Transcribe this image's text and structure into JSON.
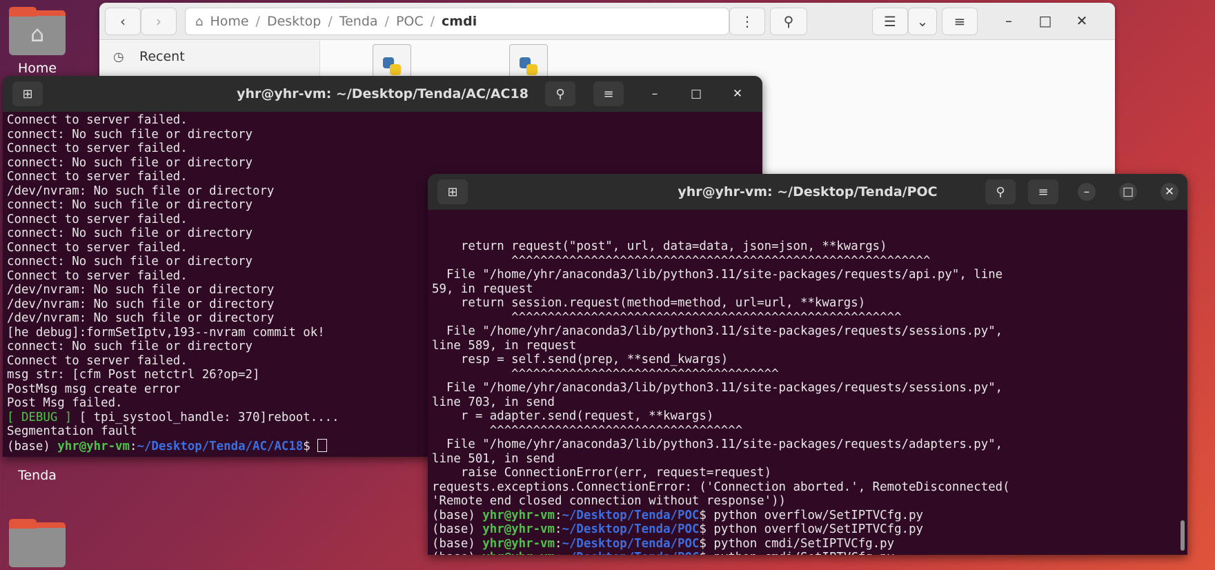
{
  "desktop": {
    "icons": [
      {
        "label": "Home"
      },
      {
        "label": "Tenda"
      },
      {
        "label": ""
      }
    ]
  },
  "file_manager": {
    "breadcrumb": [
      "Home",
      "Desktop",
      "Tenda",
      "POC",
      "cmdi"
    ],
    "sidebar": [
      {
        "label": "Recent",
        "icon": "clock-icon"
      }
    ],
    "files": [
      {
        "name": "",
        "icon": "python-file-icon"
      },
      {
        "name": "",
        "icon": "python-file-icon"
      }
    ]
  },
  "terminal_back": {
    "title": "yhr@yhr-vm: ~/Desktop/Tenda/AC/AC18",
    "lines": [
      "Connect to server failed.",
      "connect: No such file or directory",
      "Connect to server failed.",
      "connect: No such file or directory",
      "Connect to server failed.",
      "/dev/nvram: No such file or directory",
      "connect: No such file or directory",
      "Connect to server failed.",
      "connect: No such file or directory",
      "Connect to server failed.",
      "connect: No such file or directory",
      "Connect to server failed.",
      "/dev/nvram: No such file or directory",
      "/dev/nvram: No such file or directory",
      "/dev/nvram: No such file or directory",
      "[he debug]:formSetIptv,193--nvram commit ok!",
      "connect: No such file or directory",
      "Connect to server failed.",
      "msg str: [cfm Post netctrl 26?op=2]",
      "PostMsg msg create error",
      "Post Msg failed."
    ],
    "debug_tag": "[ DEBUG ]",
    "debug_rest": " [ tpi_systool_handle: 370]reboot....",
    "segfault": "Segmentation fault",
    "prompt": {
      "env": "(base) ",
      "user": "yhr@yhr-vm",
      "colon": ":",
      "path": "~/Desktop/Tenda/AC/AC18",
      "dollar": "$ "
    }
  },
  "terminal_front": {
    "title": "yhr@yhr-vm: ~/Desktop/Tenda/POC",
    "lines": [
      "    return request(\"post\", url, data=data, json=json, **kwargs)",
      "           ^^^^^^^^^^^^^^^^^^^^^^^^^^^^^^^^^^^^^^^^^^^^^^^^^^^^^^^^^^",
      "  File \"/home/yhr/anaconda3/lib/python3.11/site-packages/requests/api.py\", line",
      "59, in request",
      "    return session.request(method=method, url=url, **kwargs)",
      "           ^^^^^^^^^^^^^^^^^^^^^^^^^^^^^^^^^^^^^^^^^^^^^^^^^^^^^^",
      "  File \"/home/yhr/anaconda3/lib/python3.11/site-packages/requests/sessions.py\",",
      "line 589, in request",
      "    resp = self.send(prep, **send_kwargs)",
      "           ^^^^^^^^^^^^^^^^^^^^^^^^^^^^^^^^^^^^^",
      "  File \"/home/yhr/anaconda3/lib/python3.11/site-packages/requests/sessions.py\",",
      "line 703, in send",
      "    r = adapter.send(request, **kwargs)",
      "        ^^^^^^^^^^^^^^^^^^^^^^^^^^^^^^^^^^^",
      "  File \"/home/yhr/anaconda3/lib/python3.11/site-packages/requests/adapters.py\",",
      "line 501, in send",
      "    raise ConnectionError(err, request=request)",
      "requests.exceptions.ConnectionError: ('Connection aborted.', RemoteDisconnected(",
      "'Remote end closed connection without response'))"
    ],
    "commands": [
      "python overflow/SetIPTVCfg.py",
      "python overflow/SetIPTVCfg.py",
      "python cmdi/SetIPTVCfg.py",
      "python cmdi/SetIPTVCfg.py",
      ""
    ],
    "prompt": {
      "env": "(base) ",
      "user": "yhr@yhr-vm",
      "colon": ":",
      "path": "~/Desktop/Tenda/POC",
      "dollar": "$ "
    }
  }
}
